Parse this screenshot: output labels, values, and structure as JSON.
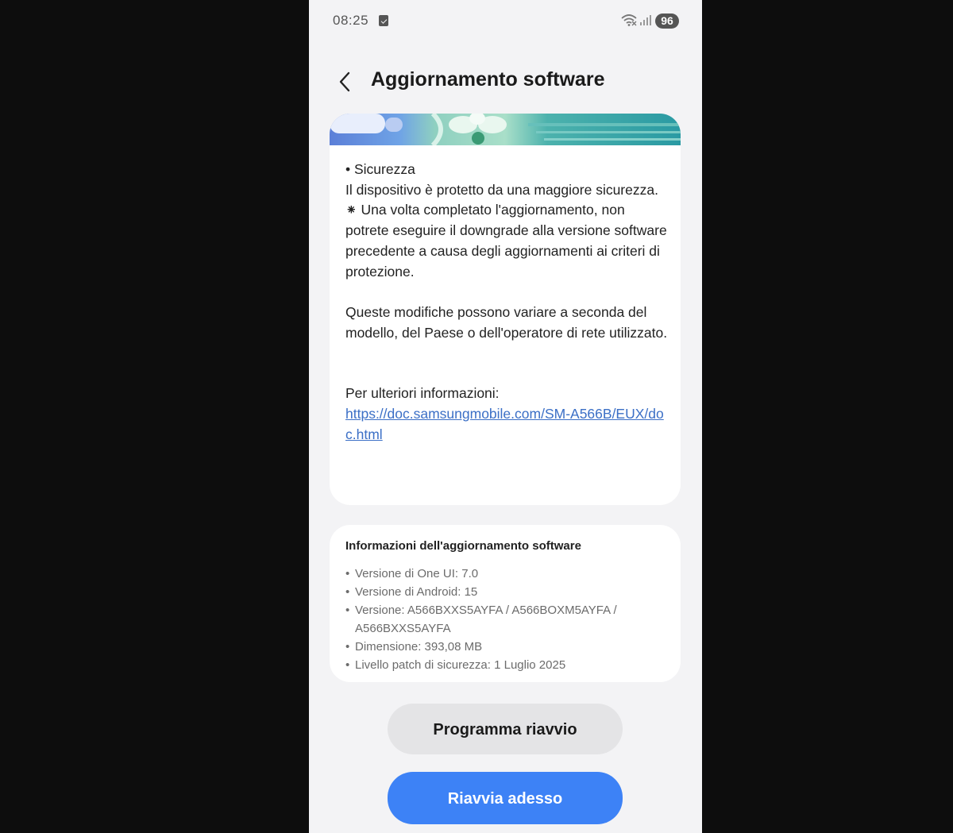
{
  "status_bar": {
    "time": "08:25",
    "battery": "96",
    "icons": [
      "notification-icon",
      "wifi-icon",
      "signal-icon"
    ]
  },
  "header": {
    "title": "Aggiornamento software",
    "back_icon": "chevron-left-icon"
  },
  "changelog": {
    "section_heading": "• Sicurezza",
    "section_body": "Il dispositivo è protetto da una maggiore sicurezza.",
    "note": "⁕ Una volta completato l'aggiornamento, non potrete eseguire il downgrade alla versione software precedente a causa degli aggiornamenti ai criteri di protezione.",
    "disclaimer": "Queste modifiche possono variare a seconda del modello, del Paese o dell'operatore di rete utilizzato.",
    "more_info_label": "Per ulteriori informazioni:",
    "more_info_link": "https://doc.samsungmobile.com/SM-A566B/EUX/doc.html"
  },
  "update_info": {
    "title": "Informazioni dell'aggiornamento software",
    "items": [
      "Versione di One UI: 7.0",
      "Versione di Android: 15",
      "Versione: A566BXXS5AYFA / A566BOXM5AYFA / A566BXXS5AYFA",
      "Dimensione: 393,08 MB",
      "Livello patch di sicurezza: 1 Luglio 2025"
    ]
  },
  "buttons": {
    "schedule_label": "Programma riavvio",
    "restart_label": "Riavvia adesso"
  },
  "colors": {
    "accent": "#3d82f6",
    "link": "#3b6fc6",
    "background": "#f3f3f5",
    "card": "#ffffff"
  }
}
